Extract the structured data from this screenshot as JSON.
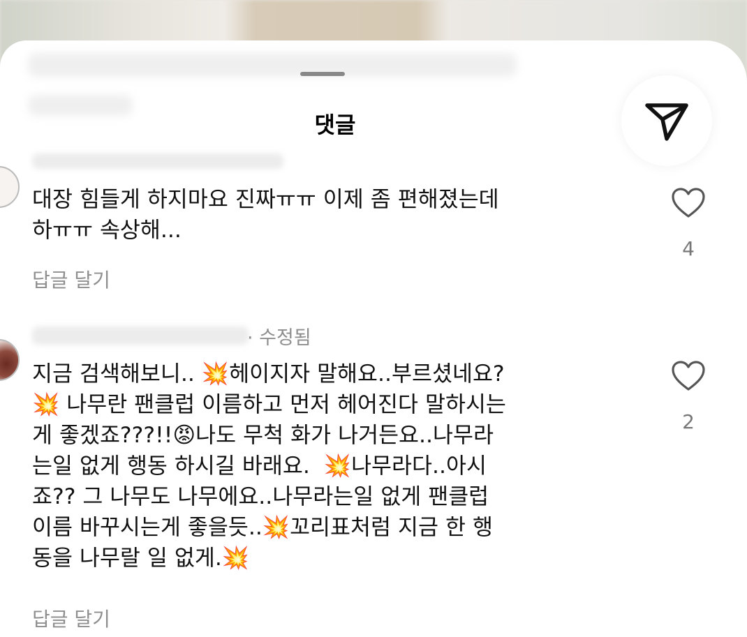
{
  "sheet": {
    "title": "댓글"
  },
  "share": {
    "icon": "paper-plane-icon"
  },
  "comments": [
    {
      "meta": "",
      "text": "대장 힘들게 하지마요 진짜ㅠㅠ 이제 좀 편해졌는데\n하ㅠㅠ 속상해...",
      "reply_label": "답글 달기",
      "like_count": "4"
    },
    {
      "meta": "· 수정됨",
      "text": "지금 검색해보니.. 💥헤이지자 말해요..부르셨네요?\n💥 나무란 팬클럽 이름하고 먼저 헤어진다 말하시는\n게 좋겠죠???!!😡나도 무척 화가 나거든요..나무라\n는일 없게 행동 하시길 바래요.  💥나무라다..아시\n죠?? 그 나무도 나무에요..나무라는일 없게 팬클럽\n이름 바꾸시는게 좋을듯..💥꼬리표처럼 지금 한 행\n동을 나무랄 일 없게.💥",
      "reply_label": "답글 달기",
      "like_count": "2"
    }
  ],
  "colors": {
    "text": "#111111",
    "muted": "#8e8e8e",
    "sheet": "#ffffff"
  }
}
